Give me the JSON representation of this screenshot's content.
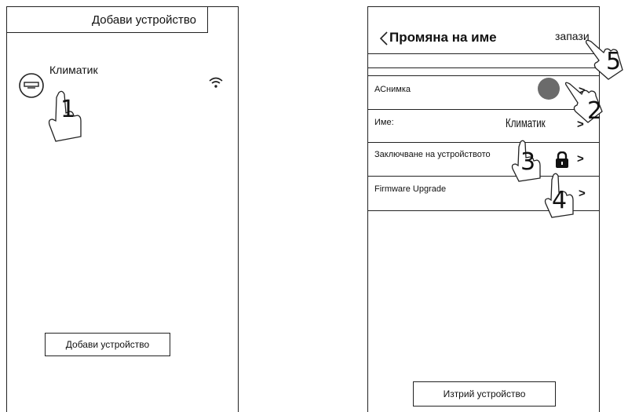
{
  "left_screen": {
    "header_title": "Добави устройство",
    "device": {
      "name": "Климатик",
      "icon": "air-conditioner-icon",
      "signal_icon": "wifi-icon"
    },
    "add_button_label": "Добави устройство",
    "step_1": "1"
  },
  "right_screen": {
    "back_icon": "chevron-left-icon",
    "title": "Промяна на име",
    "save_label": "запази",
    "rows": [
      {
        "label": "АСнимка",
        "value_icon": "avatar-circle-icon",
        "chevron": ">"
      },
      {
        "label": "Име:",
        "value": "Климатик",
        "chevron": ">"
      },
      {
        "label": "Заключване на устройството",
        "value_icon": "lock-icon",
        "chevron": ">"
      },
      {
        "label": "Firmware Upgrade",
        "chevron": ">"
      }
    ],
    "delete_button_label": "Изтрий устройство",
    "steps": {
      "s2": "2",
      "s3": "3",
      "s4": "4",
      "s5": "5"
    }
  },
  "colors": {
    "line": "#222222",
    "avatar": "#6b6b6b",
    "lock": "#111111"
  }
}
